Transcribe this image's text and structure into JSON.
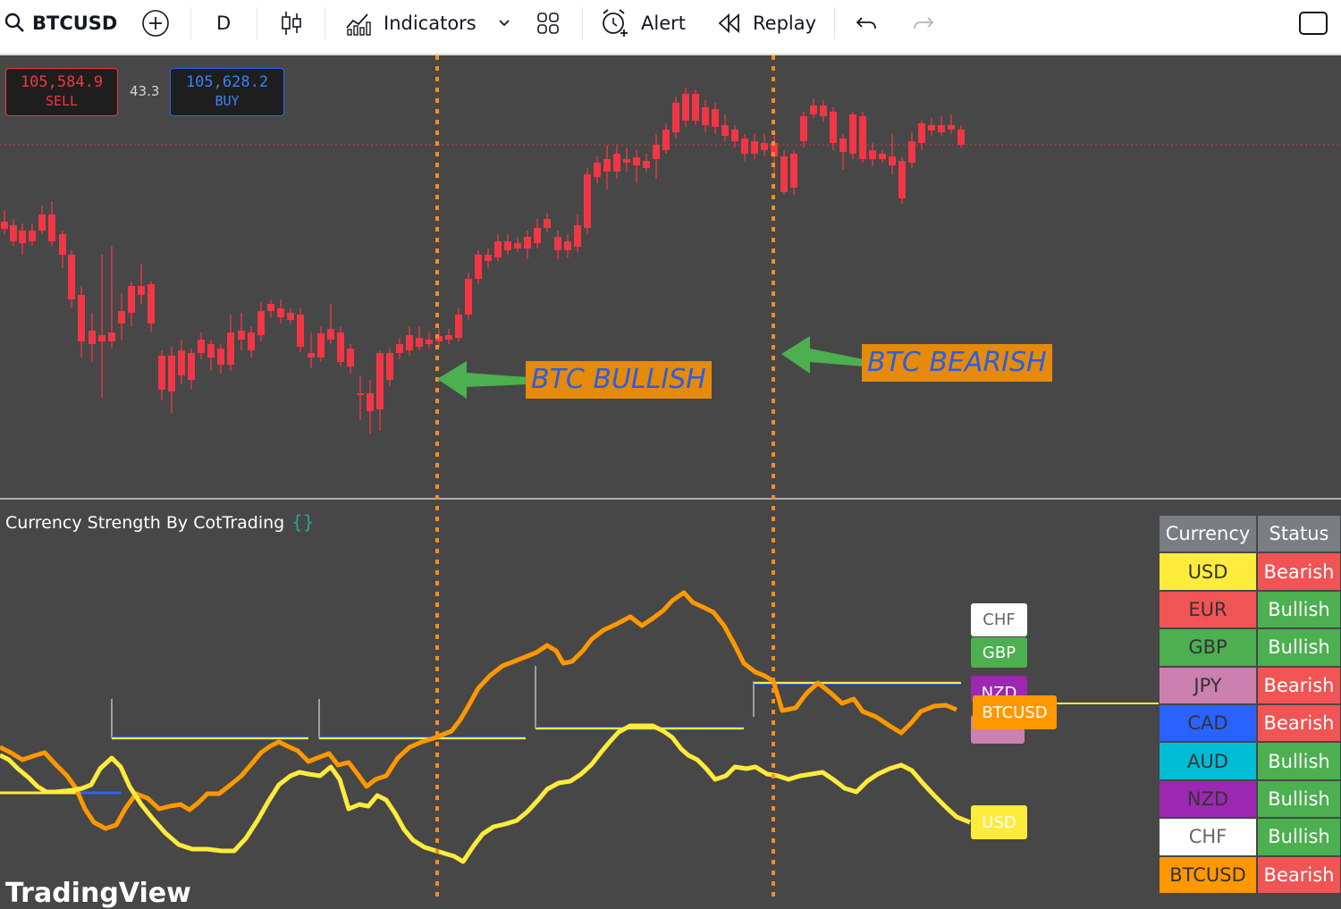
{
  "toolbar": {
    "symbol": "BTCUSD",
    "interval": "D",
    "indicators_label": "Indicators",
    "alert_label": "Alert",
    "replay_label": "Replay"
  },
  "quote": {
    "sell_price": "105,584.9",
    "sell_label": "SELL",
    "spread": "43.3",
    "buy_price": "105,628.2",
    "buy_label": "BUY"
  },
  "annotations": {
    "bullish": "BTC BULLISH",
    "bearish": "BTC BEARISH"
  },
  "indicator": {
    "title": "Currency Strength By CotTrading",
    "braces": "{}"
  },
  "line_labels": {
    "chf": "CHF",
    "gbp": "GBP",
    "nzd": "NZD",
    "btcusd": "BTCUSD",
    "usd": "USD"
  },
  "table": {
    "header": [
      "Currency",
      "Status"
    ],
    "rows": [
      {
        "currency": "USD",
        "status": "Bearish",
        "bg": "#ffeb3b",
        "fg": "#333333"
      },
      {
        "currency": "EUR",
        "status": "Bullish",
        "bg": "#f05454",
        "fg": "#333333"
      },
      {
        "currency": "GBP",
        "status": "Bullish",
        "bg": "#4caf50",
        "fg": "#333333"
      },
      {
        "currency": "JPY",
        "status": "Bearish",
        "bg": "#cc80b0",
        "fg": "#333333"
      },
      {
        "currency": "CAD",
        "status": "Bearish",
        "bg": "#2962ff",
        "fg": "#333333"
      },
      {
        "currency": "AUD",
        "status": "Bullish",
        "bg": "#00bcd4",
        "fg": "#333333"
      },
      {
        "currency": "NZD",
        "status": "Bullish",
        "bg": "#9c27b0",
        "fg": "#333333"
      },
      {
        "currency": "CHF",
        "status": "Bullish",
        "bg": "#ffffff",
        "fg": "#666666"
      },
      {
        "currency": "BTCUSD",
        "status": "Bearish",
        "bg": "#ff9800",
        "fg": "#333333"
      }
    ],
    "bearish_color": "#f05454",
    "bullish_color": "#4caf50"
  },
  "colors": {
    "up": "#22ab94",
    "down": "#f23645",
    "btc_line": "#ff9800",
    "usd_line": "#ffeb3b",
    "marker": "#ff8c1a"
  },
  "watermark": "TradingView"
}
